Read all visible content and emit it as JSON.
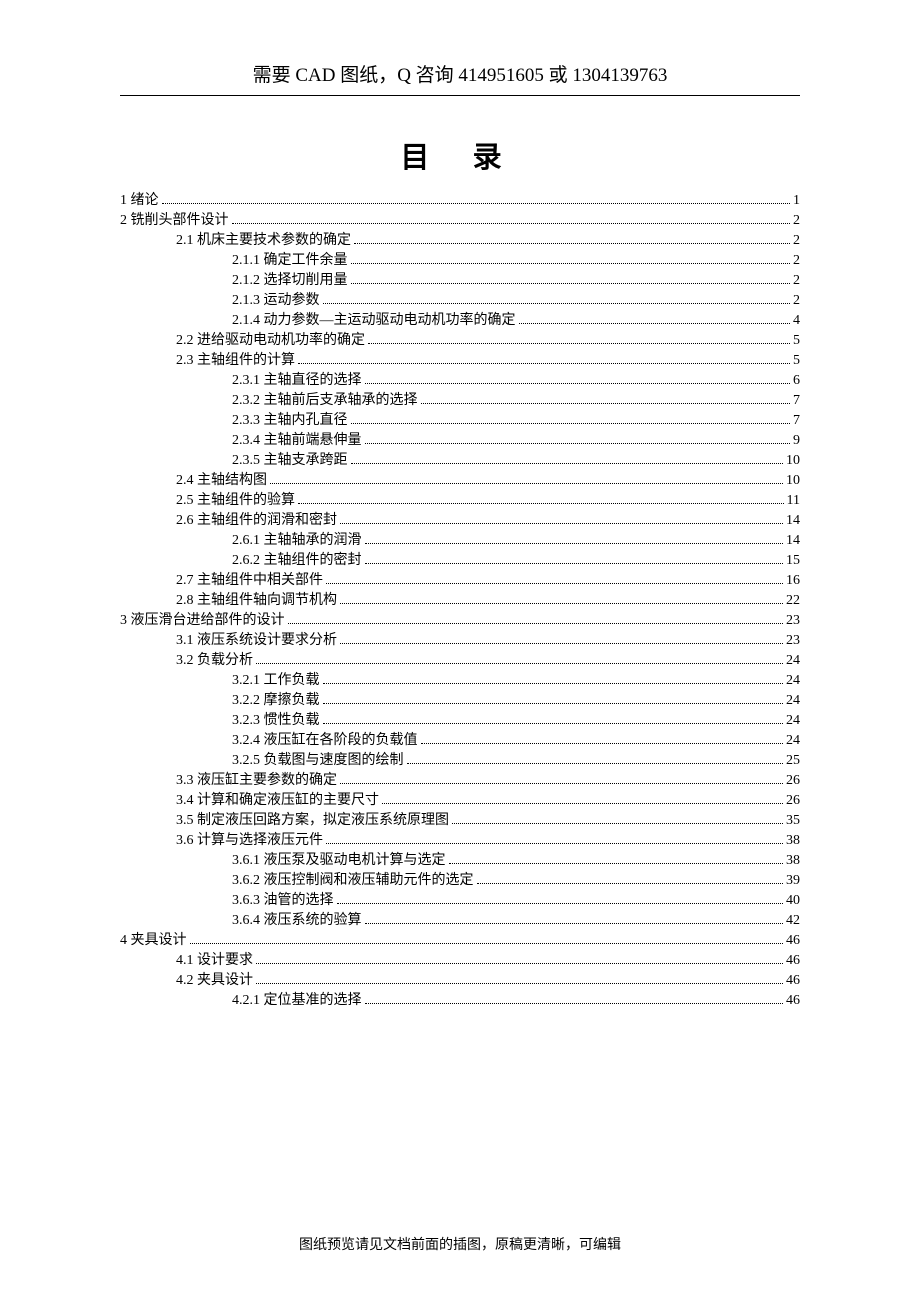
{
  "header": "需要 CAD 图纸，Q 咨询  414951605 或 1304139763",
  "title": "目  录",
  "footer": "图纸预览请见文档前面的插图，原稿更清晰，可编辑",
  "toc": [
    {
      "level": 1,
      "text": "1 绪论",
      "page": "1"
    },
    {
      "level": 1,
      "text": "2 铣削头部件设计",
      "page": "2"
    },
    {
      "level": 2,
      "text": "2.1  机床主要技术参数的确定",
      "page": "2"
    },
    {
      "level": 3,
      "text": "2.1.1  确定工件余量",
      "page": "2"
    },
    {
      "level": 3,
      "text": "2.1.2  选择切削用量",
      "page": "2"
    },
    {
      "level": 3,
      "text": "2.1.3  运动参数",
      "page": "2"
    },
    {
      "level": 3,
      "text": "2.1.4 动力参数—主运动驱动电动机功率的确定",
      "page": "4"
    },
    {
      "level": 2,
      "text": "2.2  进给驱动电动机功率的确定",
      "page": "5"
    },
    {
      "level": 2,
      "text": "2.3  主轴组件的计算",
      "page": "5"
    },
    {
      "level": 3,
      "text": "2.3.1  主轴直径的选择",
      "page": "6"
    },
    {
      "level": 3,
      "text": "2.3.2  主轴前后支承轴承的选择",
      "page": "7"
    },
    {
      "level": 3,
      "text": "2.3.3  主轴内孔直径",
      "page": "7"
    },
    {
      "level": 3,
      "text": "2.3.4  主轴前端悬伸量",
      "page": "9"
    },
    {
      "level": 3,
      "text": "2.3.5  主轴支承跨距",
      "page": "10"
    },
    {
      "level": 2,
      "text": "2.4  主轴结构图",
      "page": "10"
    },
    {
      "level": 2,
      "text": "2.5  主轴组件的验算",
      "page": "11"
    },
    {
      "level": 2,
      "text": "2.6  主轴组件的润滑和密封",
      "page": "14"
    },
    {
      "level": 3,
      "text": "2.6.1  主轴轴承的润滑",
      "page": "14"
    },
    {
      "level": 3,
      "text": "2.6.2  主轴组件的密封",
      "page": "15"
    },
    {
      "level": 2,
      "text": "2.7  主轴组件中相关部件",
      "page": "16"
    },
    {
      "level": 2,
      "text": "2.8  主轴组件轴向调节机构",
      "page": "22"
    },
    {
      "level": 1,
      "text": "3  液压滑台进给部件的设计",
      "page": "23"
    },
    {
      "level": 2,
      "text": "3.1 液压系统设计要求分析",
      "page": "23"
    },
    {
      "level": 2,
      "text": "3.2  负载分析",
      "page": "24"
    },
    {
      "level": 3,
      "text": "3.2.1  工作负载",
      "page": "24"
    },
    {
      "level": 3,
      "text": "3.2.2  摩擦负载",
      "page": "24"
    },
    {
      "level": 3,
      "text": "3.2.3  惯性负载",
      "page": "24"
    },
    {
      "level": 3,
      "text": "3.2.4  液压缸在各阶段的负载值",
      "page": "24"
    },
    {
      "level": 3,
      "text": "3.2.5  负载图与速度图的绘制",
      "page": "25"
    },
    {
      "level": 2,
      "text": "3.3  液压缸主要参数的确定",
      "page": "26"
    },
    {
      "level": 2,
      "text": "3.4  计算和确定液压缸的主要尺寸",
      "page": "26"
    },
    {
      "level": 2,
      "text": "3.5  制定液压回路方案，拟定液压系统原理图",
      "page": "35"
    },
    {
      "level": 2,
      "text": "3.6  计算与选择液压元件",
      "page": "38"
    },
    {
      "level": 3,
      "text": "3.6.1  液压泵及驱动电机计算与选定",
      "page": "38"
    },
    {
      "level": 3,
      "text": "3.6.2  液压控制阀和液压辅助元件的选定",
      "page": "39"
    },
    {
      "level": 3,
      "text": "3.6.3 油管的选择",
      "page": "40"
    },
    {
      "level": 3,
      "text": "3.6.4 液压系统的验算",
      "page": "42"
    },
    {
      "level": 1,
      "text": "4     夹具设计",
      "page": "46"
    },
    {
      "level": 2,
      "text": "4.1 设计要求",
      "page": "46"
    },
    {
      "level": 2,
      "text": "4.2 夹具设计",
      "page": "46"
    },
    {
      "level": 3,
      "text": "4.2.1  定位基准的选择",
      "page": "46"
    }
  ]
}
